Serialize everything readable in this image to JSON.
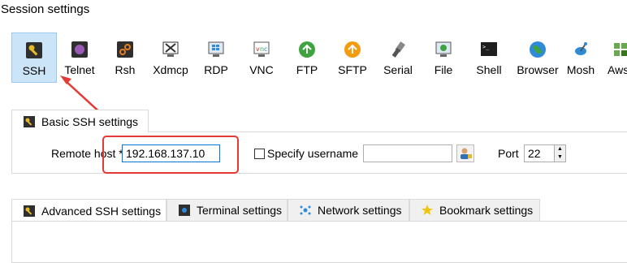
{
  "window": {
    "title": "Session settings"
  },
  "session_types": [
    {
      "label": "SSH",
      "icon": "ssh-key-icon",
      "selected": true
    },
    {
      "label": "Telnet",
      "icon": "telnet-icon"
    },
    {
      "label": "Rsh",
      "icon": "rsh-icon"
    },
    {
      "label": "Xdmcp",
      "icon": "xdmcp-icon"
    },
    {
      "label": "RDP",
      "icon": "rdp-icon"
    },
    {
      "label": "VNC",
      "icon": "vnc-icon"
    },
    {
      "label": "FTP",
      "icon": "ftp-icon"
    },
    {
      "label": "SFTP",
      "icon": "sftp-icon"
    },
    {
      "label": "Serial",
      "icon": "serial-icon"
    },
    {
      "label": "File",
      "icon": "file-icon"
    },
    {
      "label": "Shell",
      "icon": "shell-icon"
    },
    {
      "label": "Browser",
      "icon": "browser-icon"
    },
    {
      "label": "Mosh",
      "icon": "mosh-icon"
    },
    {
      "label": "Aws",
      "icon": "aws-icon"
    }
  ],
  "basic_tab": {
    "label": "Basic SSH settings"
  },
  "remote_host": {
    "label": "Remote host *",
    "value": "192.168.137.10"
  },
  "specify_username": {
    "label": "Specify username",
    "checked": false,
    "value": ""
  },
  "port": {
    "label": "Port",
    "value": "22"
  },
  "bottom_tabs": [
    {
      "label": "Advanced SSH settings",
      "icon": "ssh-key-icon"
    },
    {
      "label": "Terminal settings",
      "icon": "terminal-icon"
    },
    {
      "label": "Network settings",
      "icon": "network-icon"
    },
    {
      "label": "Bookmark settings",
      "icon": "star-icon"
    }
  ],
  "colors": {
    "selected_bg": "#cce4f7",
    "annotation_red": "#e53935",
    "key_yellow": "#e8b82a"
  }
}
